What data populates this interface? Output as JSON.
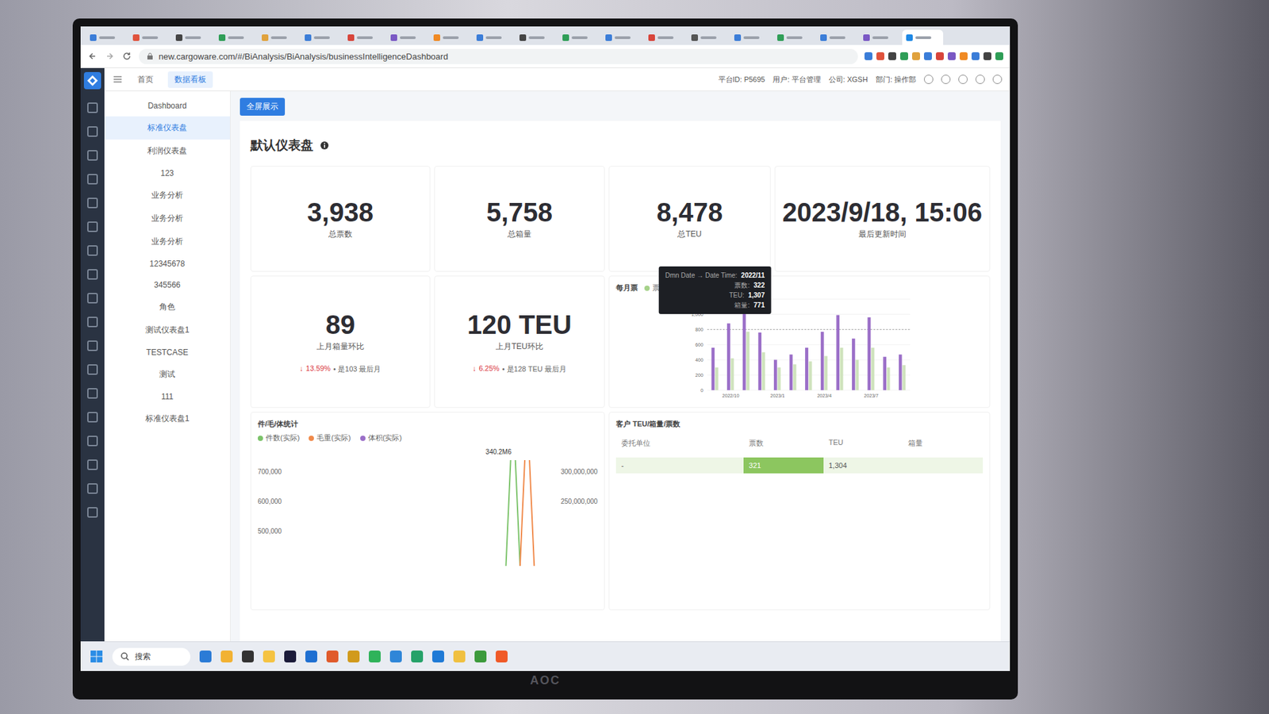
{
  "browser": {
    "tabs": [
      {
        "color": "#3b7dd8",
        "selected": false
      },
      {
        "color": "#e0533d",
        "selected": false
      },
      {
        "color": "#444444",
        "selected": false
      },
      {
        "color": "#2f9e57",
        "selected": false
      },
      {
        "color": "#e0a23d",
        "selected": false
      },
      {
        "color": "#3b7dd8",
        "selected": false
      },
      {
        "color": "#d8453b",
        "selected": false
      },
      {
        "color": "#7a58c4",
        "selected": false
      },
      {
        "color": "#f08a24",
        "selected": false
      },
      {
        "color": "#3b7dd8",
        "selected": false
      },
      {
        "color": "#444444",
        "selected": false
      },
      {
        "color": "#2f9e57",
        "selected": false
      },
      {
        "color": "#3b7dd8",
        "selected": false
      },
      {
        "color": "#d8453b",
        "selected": false
      },
      {
        "color": "#555555",
        "selected": false
      },
      {
        "color": "#3b7dd8",
        "selected": false
      },
      {
        "color": "#2f9e57",
        "selected": false
      },
      {
        "color": "#3b7dd8",
        "selected": false
      },
      {
        "color": "#7a58c4",
        "selected": false
      },
      {
        "color": "#1e88e5",
        "selected": true
      }
    ],
    "url": "new.cargoware.com/#/BiAnalysis/BiAnalysis/businessIntelligenceDashboard"
  },
  "app": {
    "nav_tabs": [
      {
        "label": "首页",
        "selected": false
      },
      {
        "label": "数据看板",
        "selected": true
      }
    ],
    "user_info": [
      "平台ID: P5695",
      "用户: 平台管理",
      "公司: XGSH",
      "部门: 操作部"
    ]
  },
  "sidebar": {
    "items": [
      {
        "label": "Dashboard",
        "selected": false
      },
      {
        "label": "标准仪表盘",
        "selected": true
      },
      {
        "label": "利润仪表盘",
        "selected": false
      },
      {
        "label": "123",
        "selected": false
      },
      {
        "label": "业务分析",
        "selected": false
      },
      {
        "label": "业务分析",
        "selected": false
      },
      {
        "label": "业务分析",
        "selected": false
      },
      {
        "label": "12345678",
        "selected": false
      },
      {
        "label": "345566",
        "selected": false
      },
      {
        "label": "角色",
        "selected": false
      },
      {
        "label": "测试仪表盘1",
        "selected": false
      },
      {
        "label": "TESTCASE",
        "selected": false
      },
      {
        "label": "测试",
        "selected": false
      },
      {
        "label": "111",
        "selected": false
      },
      {
        "label": "标准仪表盘1",
        "selected": false
      }
    ]
  },
  "dashboard": {
    "fullscreen_button": "全屏展示",
    "title": "默认仪表盘",
    "kpis": [
      {
        "value": "3,938",
        "label": "总票数"
      },
      {
        "value": "5,758",
        "label": "总箱量"
      },
      {
        "value": "8,478",
        "label": "总TEU"
      },
      {
        "value": "2023/9/18, 15:06",
        "label": "最后更新时间"
      }
    ],
    "comparisons": [
      {
        "value": "89",
        "label": "上月箱量环比",
        "arrow": "↓",
        "change": "13.59%",
        "note": "• 是103 最后月"
      },
      {
        "value": "120 TEU",
        "label": "上月TEU环比",
        "arrow": "↓",
        "change": "6.25%",
        "note": "• 是128 TEU 最后月"
      }
    ],
    "monthly_chart": {
      "title": "每月票",
      "legend": [
        {
          "label": "票数",
          "color": "#a6d28a"
        }
      ],
      "y_max": 1200,
      "y_ticks": [
        "1,200",
        "1,000",
        "800",
        "600",
        "400",
        "200",
        "0"
      ],
      "x_labels": [
        {
          "label": "2022/10",
          "index": 1
        },
        {
          "label": "2023/1",
          "index": 4
        },
        {
          "label": "2023/4",
          "index": 7
        },
        {
          "label": "2023/7",
          "index": 10
        }
      ],
      "reference_line": 800,
      "series": [
        {
          "color": "#9b6fc8",
          "values": [
            560,
            880,
            1307,
            760,
            400,
            470,
            560,
            770,
            990,
            680,
            960,
            440,
            470
          ]
        },
        {
          "color": "#cfe3bd",
          "values": [
            300,
            420,
            771,
            500,
            300,
            340,
            380,
            450,
            560,
            400,
            560,
            300,
            330
          ]
        }
      ],
      "tooltip": {
        "bar_index": 2,
        "title": "Dmn Date → Date Time:",
        "title_value": "2022/11",
        "rows": [
          {
            "label": "票数",
            "value": "322"
          },
          {
            "label": "TEU",
            "value": "1,307"
          },
          {
            "label": "箱量",
            "value": "771"
          }
        ]
      }
    },
    "stat_chart": {
      "title": "件/毛/体统计",
      "legend": [
        {
          "label": "件数(实际)",
          "color": "#7cc36a"
        },
        {
          "label": "毛重(实际)",
          "color": "#f08a4b"
        },
        {
          "label": "体积(实际)",
          "color": "#9b6fc8"
        }
      ],
      "left_ticks": [
        "700,000",
        "600,000",
        "500,000"
      ],
      "right_ticks": [
        "300,000,000",
        "250,000,000"
      ],
      "peak_label": "340.2M6",
      "series": [
        {
          "color": "#7cc36a",
          "values": [
            0,
            0,
            0,
            0,
            0,
            0,
            0,
            0,
            0,
            0,
            0,
            0,
            0,
            0,
            0,
            0,
            900000,
            0,
            0,
            0
          ]
        },
        {
          "color": "#f08a4b",
          "values": [
            0,
            0,
            0,
            0,
            0,
            0,
            0,
            0,
            0,
            0,
            0,
            0,
            0,
            0,
            0,
            0,
            0,
            900000,
            0,
            0
          ]
        }
      ]
    },
    "customer_table": {
      "title": "客户 TEU/箱量/票数",
      "columns": [
        "委托单位",
        "票数",
        "TEU",
        "箱量"
      ],
      "rows": [
        {
          "cells": [
            "-",
            "321",
            "1,304",
            ""
          ]
        }
      ]
    }
  },
  "taskbar": {
    "search": "搜索",
    "apps": [
      {
        "color": "#2b7bd6"
      },
      {
        "color": "#f2b233"
      },
      {
        "color": "#333333"
      },
      {
        "color": "#f5c342"
      },
      {
        "color": "#1b1b3a"
      },
      {
        "color": "#1f6fd1"
      },
      {
        "color": "#e05a2b"
      },
      {
        "color": "#d19a1c"
      },
      {
        "color": "#2fb35a"
      },
      {
        "color": "#2f86d8"
      },
      {
        "color": "#26a269"
      },
      {
        "color": "#1f7ad6"
      },
      {
        "color": "#f0c040"
      },
      {
        "color": "#3c9a3c"
      },
      {
        "color": "#f05a28"
      }
    ]
  },
  "monitor": {
    "brand": "AOC"
  }
}
